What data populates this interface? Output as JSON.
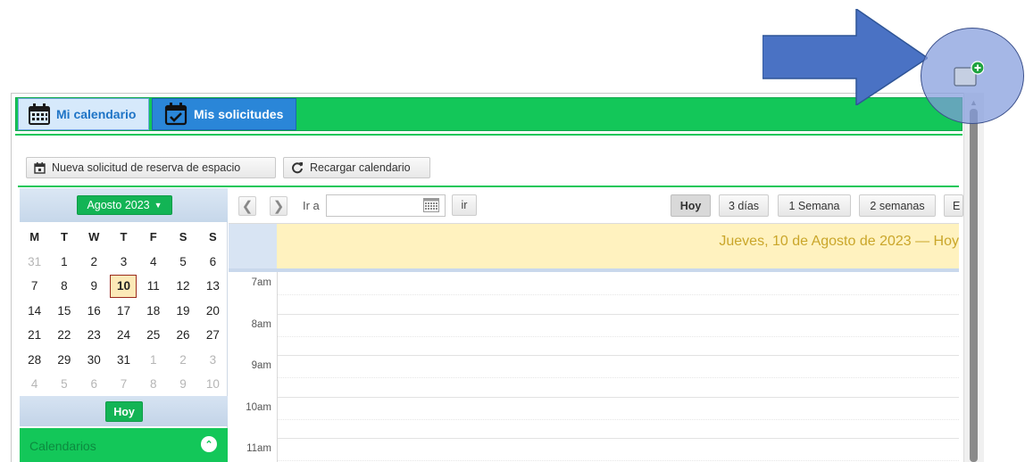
{
  "tabs": [
    {
      "label": "Mi calendario",
      "icon": "calendar-icon",
      "active": true
    },
    {
      "label": "Mis solicitudes",
      "icon": "calendar-check-icon",
      "active": false
    }
  ],
  "actions": {
    "new_request": "Nueva solicitud de reserva de espacio",
    "reload": "Recargar calendario"
  },
  "mini_calendar": {
    "month_label": "Agosto 2023",
    "weekday_headers": [
      "M",
      "T",
      "W",
      "T",
      "F",
      "S",
      "S"
    ],
    "weeks": [
      [
        {
          "d": "31",
          "dim": true
        },
        {
          "d": "1"
        },
        {
          "d": "2"
        },
        {
          "d": "3"
        },
        {
          "d": "4"
        },
        {
          "d": "5"
        },
        {
          "d": "6"
        }
      ],
      [
        {
          "d": "7"
        },
        {
          "d": "8"
        },
        {
          "d": "9"
        },
        {
          "d": "10",
          "today": true
        },
        {
          "d": "11"
        },
        {
          "d": "12"
        },
        {
          "d": "13"
        }
      ],
      [
        {
          "d": "14"
        },
        {
          "d": "15"
        },
        {
          "d": "16"
        },
        {
          "d": "17"
        },
        {
          "d": "18"
        },
        {
          "d": "19"
        },
        {
          "d": "20"
        }
      ],
      [
        {
          "d": "21"
        },
        {
          "d": "22"
        },
        {
          "d": "23"
        },
        {
          "d": "24"
        },
        {
          "d": "25"
        },
        {
          "d": "26"
        },
        {
          "d": "27"
        }
      ],
      [
        {
          "d": "28"
        },
        {
          "d": "29"
        },
        {
          "d": "30"
        },
        {
          "d": "31"
        },
        {
          "d": "1",
          "dim": true
        },
        {
          "d": "2",
          "dim": true
        },
        {
          "d": "3",
          "dim": true
        }
      ],
      [
        {
          "d": "4",
          "dim": true
        },
        {
          "d": "5",
          "dim": true
        },
        {
          "d": "6",
          "dim": true
        },
        {
          "d": "7",
          "dim": true
        },
        {
          "d": "8",
          "dim": true
        },
        {
          "d": "9",
          "dim": true
        },
        {
          "d": "10",
          "dim": true
        }
      ]
    ],
    "today_button": "Hoy"
  },
  "calendars_section": {
    "label": "Calendarios"
  },
  "toolbar": {
    "goto_label": "Ir a",
    "goto_value": "",
    "go_button": "ir",
    "views": [
      {
        "label": "Hoy",
        "active": true
      },
      {
        "label": "3 días"
      },
      {
        "label": "1 Semana"
      },
      {
        "label": "2 semanas"
      },
      {
        "label": "E"
      }
    ]
  },
  "day_view": {
    "title": "Jueves, 10 de Agosto de 2023 — Hoy",
    "hours": [
      "7am",
      "8am",
      "9am",
      "10am",
      "11am"
    ]
  },
  "colors": {
    "brand_green": "#13c759",
    "tab_blue": "#2a86d8",
    "today_highlight": "#fff2bf",
    "annotation_arrow": "#4a72c4"
  },
  "annotation": {
    "target": "add-calendar-icon"
  }
}
